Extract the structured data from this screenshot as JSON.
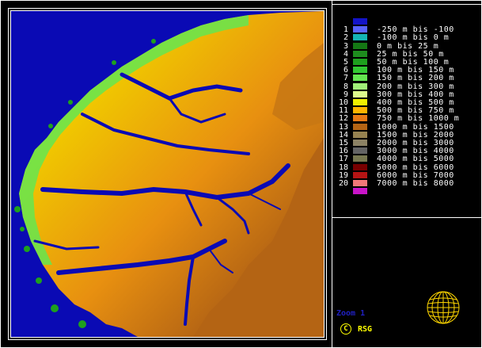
{
  "legend": {
    "items": [
      {
        "num": "",
        "label": "",
        "color": "#1414c8"
      },
      {
        "num": "1",
        "label": "-250 m bis -100",
        "color": "#5a64ff"
      },
      {
        "num": "2",
        "label": "-100 m bis 0 m",
        "color": "#14b4b4"
      },
      {
        "num": "3",
        "label": "0 m bis 25 m",
        "color": "#147814"
      },
      {
        "num": "4",
        "label": "25 m bis 50 m",
        "color": "#1e8c1e"
      },
      {
        "num": "5",
        "label": "50 m bis 100 m",
        "color": "#1ea01e"
      },
      {
        "num": "6",
        "label": "100 m bis 150 m",
        "color": "#32c832"
      },
      {
        "num": "7",
        "label": "150 m bis 200 m",
        "color": "#64e650"
      },
      {
        "num": "8",
        "label": "200 m bis 300 m",
        "color": "#a0f078"
      },
      {
        "num": "9",
        "label": "300 m bis 400 m",
        "color": "#dcfa8c"
      },
      {
        "num": "10",
        "label": "400 m bis 500 m",
        "color": "#f0f000"
      },
      {
        "num": "11",
        "label": "500 m bis 750 m",
        "color": "#ffb400"
      },
      {
        "num": "12",
        "label": "750 m bis 1000 m",
        "color": "#e67814"
      },
      {
        "num": "13",
        "label": "1000 m bis 1500",
        "color": "#b46414"
      },
      {
        "num": "14",
        "label": "1500 m bis 2000",
        "color": "#968250"
      },
      {
        "num": "15",
        "label": "2000 m bis 3000",
        "color": "#8c8264"
      },
      {
        "num": "16",
        "label": "3000 m bis 4000",
        "color": "#646464"
      },
      {
        "num": "17",
        "label": "4000 m bis 5000",
        "color": "#787850"
      },
      {
        "num": "18",
        "label": "5000 m bis 6000",
        "color": "#780000"
      },
      {
        "num": "19",
        "label": "6000 m bis 7000",
        "color": "#b41414"
      },
      {
        "num": "20",
        "label": "7000 m bis 8000",
        "color": "#f07878"
      },
      {
        "num": "",
        "label": "",
        "color": "#c814c8"
      }
    ]
  },
  "footer": {
    "zoom_label": "Zoom 1",
    "copyright_symbol": "C",
    "copyright_text": "RSG"
  },
  "colors": {
    "sea": "#0a0ab4",
    "lowland": "#c8f064",
    "midland": "#f0b400",
    "highland": "#b46414",
    "fjord": "#0a0ab4",
    "globe": "#ffd700"
  }
}
